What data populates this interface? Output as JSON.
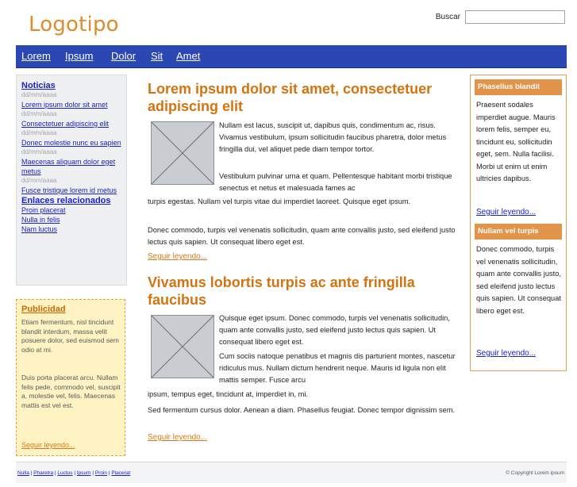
{
  "header": {
    "logo": "Logotipo",
    "search_label": "Buscar",
    "search_value": ""
  },
  "nav": {
    "items": [
      "Lorem",
      "Ipsum",
      "Dolor",
      "Sit",
      "Amet"
    ]
  },
  "left_sidebar": {
    "news_title": "Noticias",
    "news": [
      {
        "date": "dd/mm/aaaa",
        "text": "Lorem ipsum dolor sit amet"
      },
      {
        "date": "dd/mm/aaaa",
        "text": "Consectetuer adipiscing elit"
      },
      {
        "date": "dd/mm/aaaa",
        "text": "Donec molestie nunc eu sapien"
      },
      {
        "date": "dd/mm/aaaa",
        "text": "Maecenas aliquam dolor eget metus"
      },
      {
        "date": "dd/mm/aaaa",
        "text": "Fusce tristique lorem id metus"
      }
    ],
    "related_title": "Enlaces relacionados",
    "related": [
      "Proin placerat",
      "Nulla in felis",
      "Nam luctus"
    ],
    "ad": {
      "title": "Publicidad",
      "para1": "Etiam fermentum, nisl tincidunt blandit interdum, massa velit posuere dolor, sed euismod sem odio at mi.",
      "para2": "Duis porta placerat arcu. Nullam felis pede, commodo vel, suscipit a, molestie vel, felis. Maecenas mattis est vel est.",
      "read_more": "Seguir leyendo..."
    }
  },
  "main": {
    "article1": {
      "title": "Lorem ipsum dolor sit amet, consectetuer adipiscing elit",
      "para1": "Nullam est lacus, suscipit ut, dapibus quis, condimentum ac, risus. Vivamus vestibulum, ipsum sollicitudin faucibus pharetra, dolor metus fringilla dui, vel aliquet pede diam tempor tortor.",
      "para2_a": "Vestibulum pulvinar urna et quam. Pellentesque habitant morbi tristique senectus et netus et malesuada fames ac",
      "para2_b": "turpis egestas. Nullam vel turpis vitae dui imperdiet laoreet. Quisque eget ipsum.",
      "para3": "Donec commodo, turpis vel venenatis sollicitudin, quam ante convallis justo, sed eleifend justo lectus quis sapien. Ut consequat libero eget est.",
      "read_more": "Seguir leyendo..."
    },
    "article2": {
      "title": "Vivamus lobortis turpis ac ante fringilla faucibus",
      "para1": "Quisque eget ipsum. Donec commodo, turpis vel venenatis sollicitudin, quam ante convallis justo, sed eleifend justo lectus quis sapien. Ut consequat libero eget est.",
      "para2_a": "Cum sociis natoque penatibus et magnis dis parturient montes, nascetur ridiculus mus. Nullam dictum hendrerit neque. Mauris id ligula non elit mattis semper. Fusce arcu",
      "para2_b": "ipsum, tempus eget, tincidunt at, imperdiet in, mi.",
      "para3": "Sed fermentum cursus dolor. Aenean a diam. Phasellus feugiat. Donec tempor dignissim sem.",
      "read_more": "Seguir leyendo..."
    }
  },
  "right_sidebar": {
    "block1": {
      "title": "Phasellus blandit",
      "text": "Praesent sodales imperdiet augue. Mauris lorem felis, semper eu, tincidunt eu, sollicitudin eget, sem. Nulla facilisi. Morbi ut enim ut enim ultricies dapibus.",
      "read_more": "Seguir leyendo..."
    },
    "block2": {
      "title": "Nullam vel turpis",
      "text": "Donec commodo, turpis vel venenatis sollicitudin, quam ante convallis justo, sed eleifend justo lectus quis sapien. Ut consequat libero eget est.",
      "read_more": "Seguir leyendo..."
    }
  },
  "footer": {
    "links": [
      "Nulla",
      "Pharetra",
      "Luctus",
      "Ipsum",
      "Proin",
      "Placerat"
    ],
    "copyright": "© Copyright Lorem ipsum"
  },
  "colors": {
    "nav_blue": "#2b47b3",
    "accent_orange": "#d4730f",
    "link_blue": "#1a22c8",
    "ad_background": "#fff3c4"
  }
}
